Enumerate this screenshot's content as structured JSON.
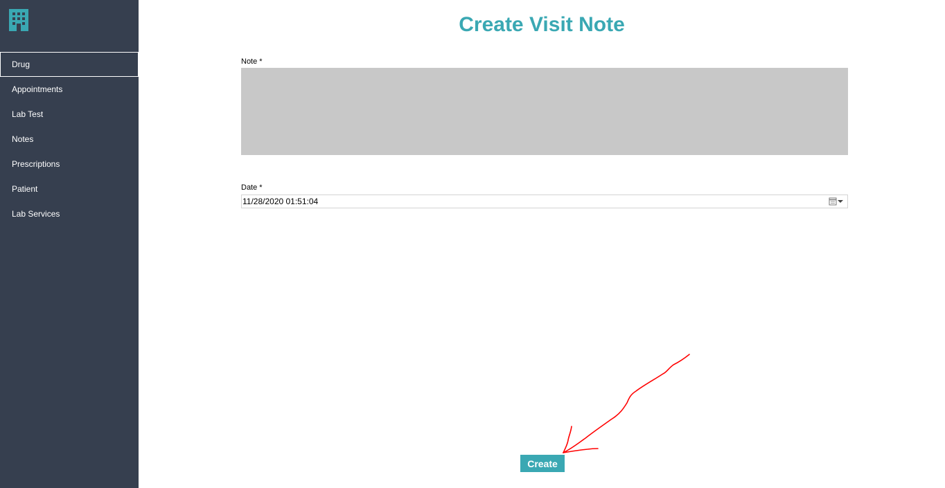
{
  "app": {
    "logo_icon": "hospital-building-icon",
    "accent_color": "#3aa8b3",
    "sidebar_color": "#363f4f"
  },
  "sidebar": {
    "items": [
      {
        "label": "Drug",
        "active": true
      },
      {
        "label": "Appointments",
        "active": false
      },
      {
        "label": "Lab Test",
        "active": false
      },
      {
        "label": "Notes",
        "active": false
      },
      {
        "label": "Prescriptions",
        "active": false
      },
      {
        "label": "Patient",
        "active": false
      },
      {
        "label": "Lab Services",
        "active": false
      }
    ]
  },
  "form": {
    "title": "Create Visit Note",
    "note_label": "Note *",
    "note_value": "",
    "date_label": "Date *",
    "date_value": "11/28/2020 01:51:04",
    "date_picker_icon": "calendar-dropdown-icon",
    "submit_label": "Create"
  },
  "annotation": {
    "icon": "hand-drawn-arrow-icon",
    "color": "#ff0000"
  }
}
